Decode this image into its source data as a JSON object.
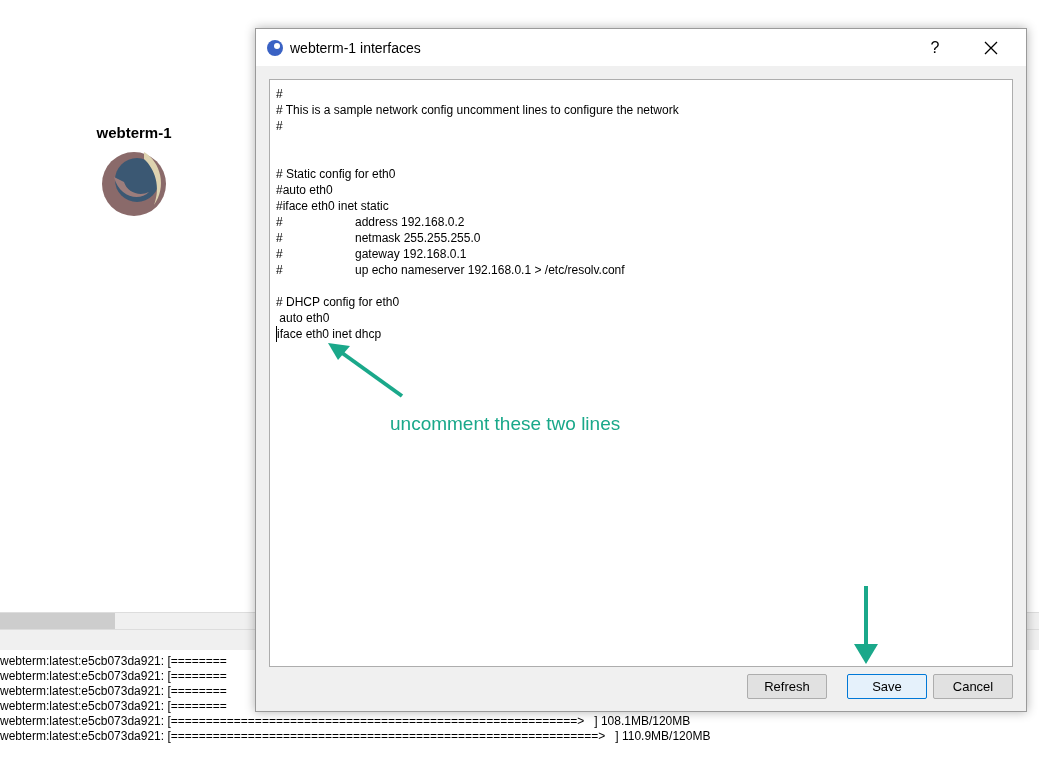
{
  "node": {
    "label": "webterm-1"
  },
  "log_lines": [
    "webterm:latest:e5cb073da921: [========",
    "webterm:latest:e5cb073da921: [========",
    "webterm:latest:e5cb073da921: [========",
    "webterm:latest:e5cb073da921: [========",
    "webterm:latest:e5cb073da921: [==========================================================>   ] 108.1MB/120MB",
    "webterm:latest:e5cb073da921: [=============================================================>   ] 110.9MB/120MB"
  ],
  "dialog": {
    "title": "webterm-1 interfaces",
    "help": "?",
    "editor_blocks": [
      {
        "kind": "first",
        "lines": [
          "#",
          "# This is a sample network config uncomment lines to configure the network",
          "#"
        ]
      },
      {
        "kind": "wide",
        "lines": [
          "# Static config for eth0",
          "#auto eth0",
          "#iface eth0 inet static",
          "#\taddress 192.168.0.2",
          "#\tnetmask 255.255.255.0",
          "#\tgateway 192.168.0.1",
          "#\tup echo nameserver 192.168.0.1 > /etc/resolv.conf"
        ]
      },
      {
        "kind": "near",
        "lines": [
          "# DHCP config for eth0",
          " auto eth0",
          "iface eth0 inet dhcp"
        ]
      }
    ],
    "buttons": [
      {
        "label": "Refresh",
        "default": false
      },
      {
        "label": "Save",
        "default": true
      },
      {
        "label": "Cancel",
        "default": false
      }
    ]
  },
  "annotation": {
    "text": "uncomment these two lines"
  }
}
